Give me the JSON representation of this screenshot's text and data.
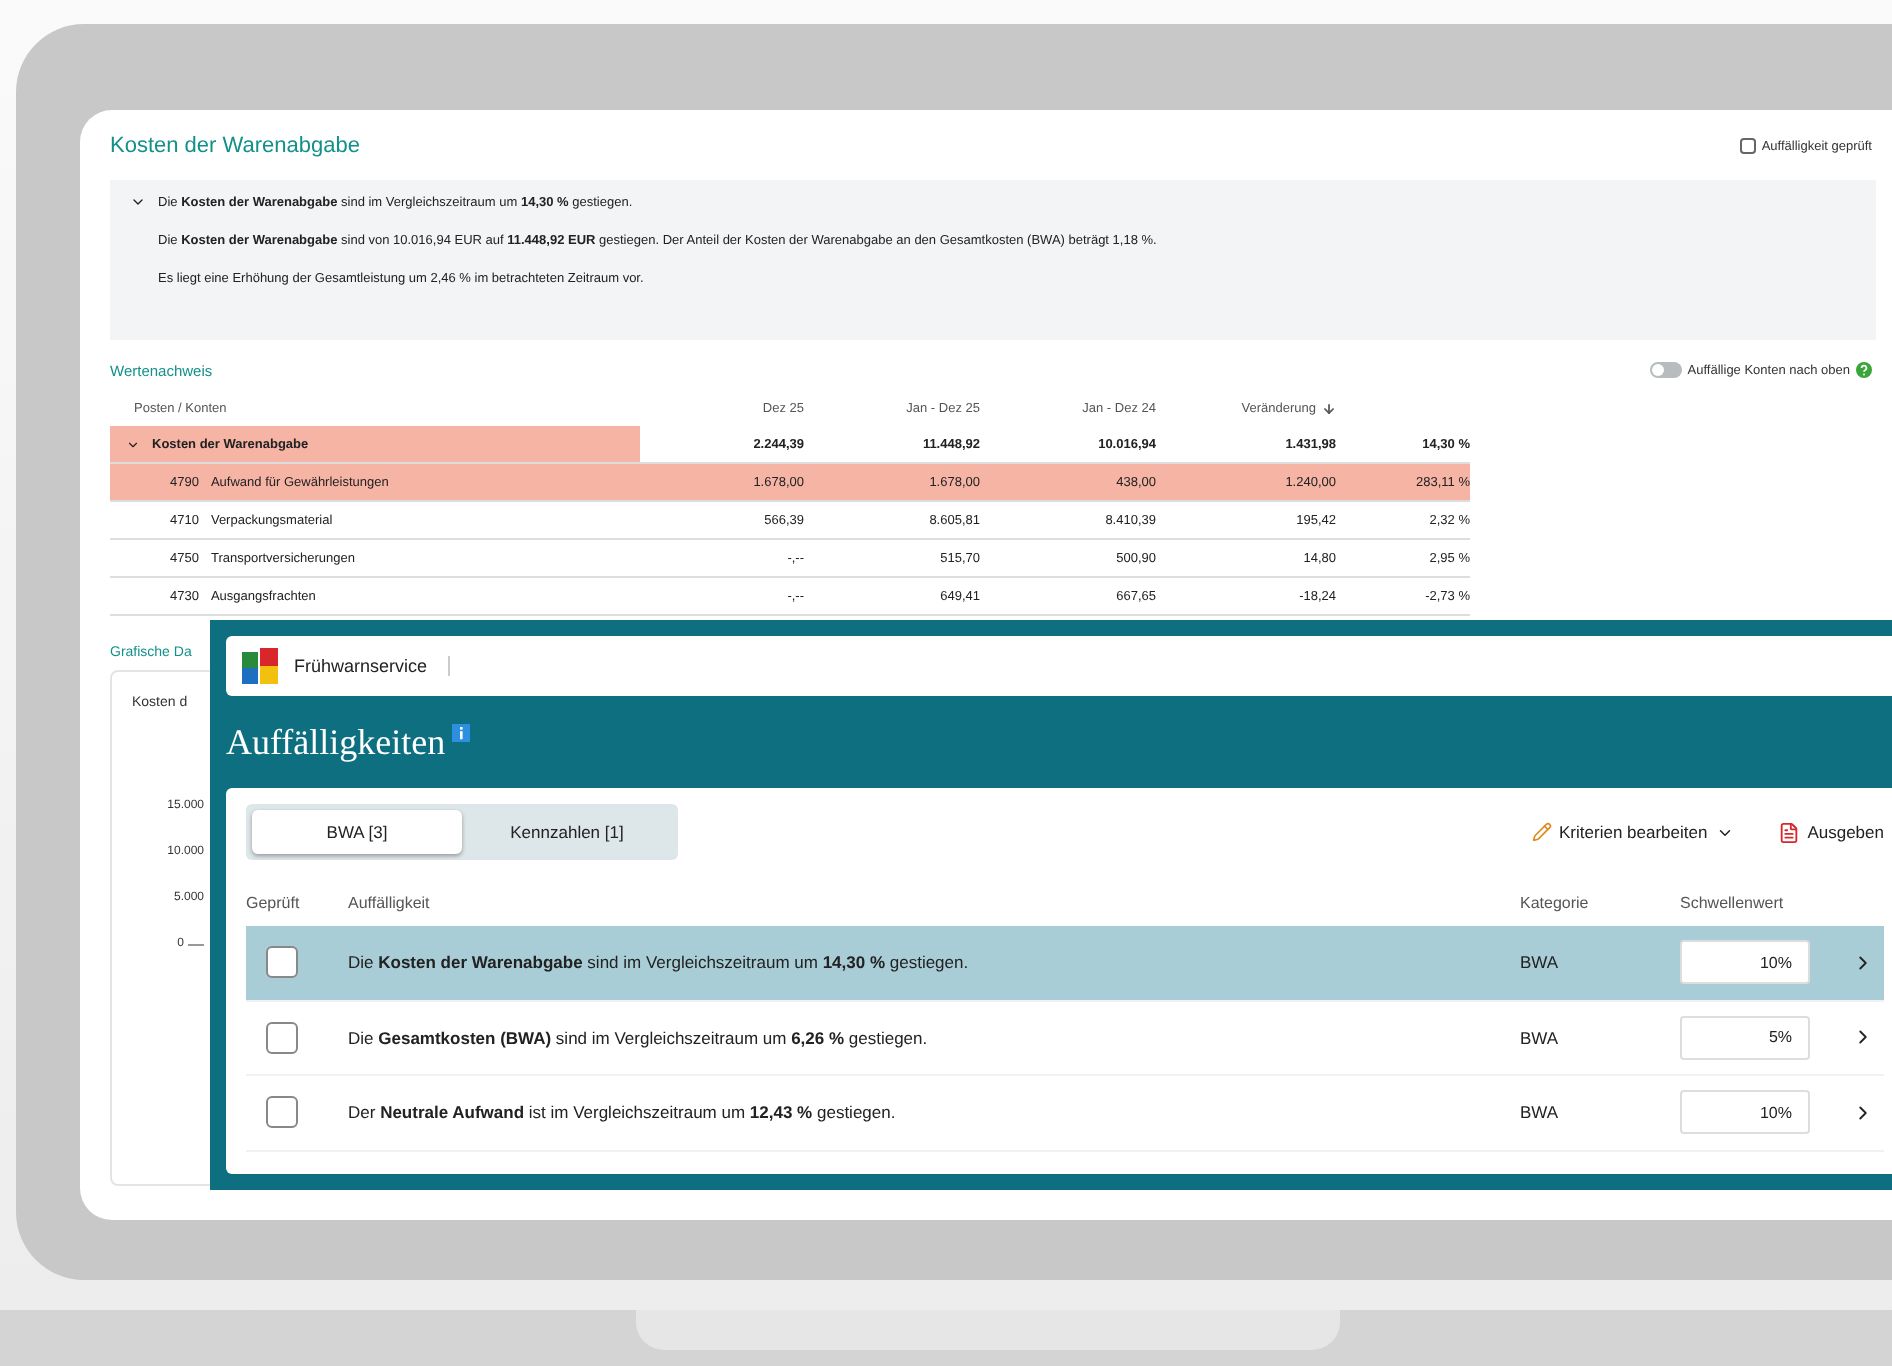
{
  "screen": {
    "header": {
      "title": "Kosten der Warenabgabe",
      "reviewed": {
        "label": "Auffälligkeit geprüft",
        "checked": false
      }
    },
    "summary": {
      "expanded": true,
      "headline": "Die **Kosten der Warenabgabe** sind im Vergleichszeitraum um **14,30 %** gestiegen.",
      "paragraphs": [
        "Die **Kosten der Warenabgabe** sind von 10.016,94 EUR auf **11.448,92 EUR** gestiegen. Der Anteil der Kosten der Warenabgabe an den Gesamtkosten (BWA) beträgt 1,18 %.",
        "Es liegt eine Erhöhung der Gesamtleistung um 2,46 % im betrachteten Zeitraum vor."
      ]
    },
    "values_section": {
      "title": "Wertenachweis",
      "toggle": {
        "label": "Auffällige Konten nach oben",
        "on": false
      },
      "table": {
        "columns": [
          "Posten / Konten",
          "Dez 25",
          "Jan - Dez 25",
          "Jan - Dez 24",
          "Veränderung"
        ],
        "rows": [
          {
            "kind": "group",
            "expanded": true,
            "highlighted": true,
            "label": "Kosten der Warenabgabe",
            "values": [
              "2.244,39",
              "11.448,92",
              "10.016,94",
              "1.431,98",
              "14,30 %"
            ]
          },
          {
            "kind": "account",
            "highlighted": true,
            "number": "4790",
            "label": "Aufwand für Gewährleistungen",
            "values": [
              "1.678,00",
              "1.678,00",
              "438,00",
              "1.240,00",
              "283,11 %"
            ]
          },
          {
            "kind": "account",
            "highlighted": false,
            "number": "4710",
            "label": "Verpackungsmaterial",
            "values": [
              "566,39",
              "8.605,81",
              "8.410,39",
              "195,42",
              "2,32 %"
            ]
          },
          {
            "kind": "account",
            "highlighted": false,
            "number": "4750",
            "label": "Transportversicherungen",
            "values": [
              "-,--",
              "515,70",
              "500,90",
              "14,80",
              "2,95 %"
            ]
          },
          {
            "kind": "account",
            "highlighted": false,
            "number": "4730",
            "label": "Ausgangsfrachten",
            "values": [
              "-,--",
              "649,41",
              "667,65",
              "-18,24",
              "-2,73 %"
            ]
          }
        ]
      }
    },
    "chart_section": {
      "title": "Grafische Da",
      "card_title": "Kosten d",
      "y_ticks": [
        "15.000",
        "10.000",
        "5.000",
        "0"
      ]
    }
  },
  "overlay": {
    "app_name": "Frühwarnservice",
    "title": "Auffälligkeiten",
    "tabs": [
      {
        "label": "BWA [3]",
        "selected": true
      },
      {
        "label": "Kennzahlen [1]",
        "selected": false
      }
    ],
    "actions": [
      {
        "kind": "edit",
        "label": "Kriterien bearbeiten"
      },
      {
        "kind": "export",
        "label": "Ausgeben"
      }
    ],
    "columns": [
      "Geprüft",
      "Auffälligkeit",
      "Kategorie",
      "Schwellenwert"
    ],
    "rows": [
      {
        "selected": true,
        "checked": false,
        "text": "Die **Kosten der Warenabgabe** sind im Vergleichszeitraum um **14,30 %** gestiegen.",
        "category": "BWA",
        "threshold": "10%"
      },
      {
        "selected": false,
        "checked": false,
        "text": "Die **Gesamtkosten (BWA)** sind im Vergleichszeitraum um **6,26 %** gestiegen.",
        "category": "BWA",
        "threshold": "5%"
      },
      {
        "selected": false,
        "checked": false,
        "text": "Der **Neutrale Aufwand** ist im Vergleichszeitraum um **12,43 %** gestiegen.",
        "category": "BWA",
        "threshold": "10%"
      }
    ]
  }
}
